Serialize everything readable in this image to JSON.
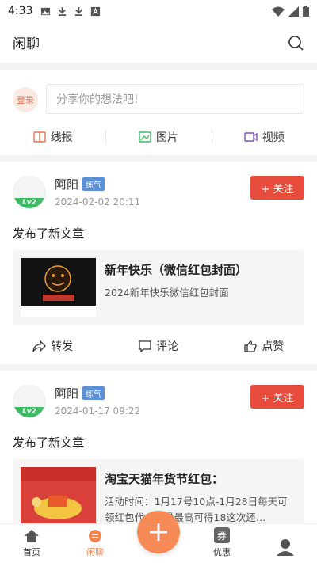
{
  "status_bar": {
    "time": "4:33",
    "icons": [
      "image-icon",
      "download-icon",
      "download-icon",
      "a-box-icon"
    ],
    "right_icons": [
      "wifi-icon",
      "signal-icon",
      "battery-icon"
    ]
  },
  "header": {
    "title": "闲聊",
    "search_icon": "search-icon"
  },
  "composer": {
    "login_label": "登录",
    "placeholder": "分享你的想法吧!",
    "types": [
      {
        "label": "线报",
        "icon": "book-icon",
        "color": "#e8734a"
      },
      {
        "label": "图片",
        "icon": "image-icon",
        "color": "#3dbb63"
      },
      {
        "label": "视频",
        "icon": "video-icon",
        "color": "#7a4fc9"
      }
    ]
  },
  "posts": [
    {
      "user": "阿阳",
      "badge": "练气",
      "level": "Lv2",
      "date": "2024-02-02 20:11",
      "follow_label": "+ 关注",
      "action": "发布了新文章",
      "article": {
        "title": "新年快乐（微信红包封面）",
        "desc": "2024新年快乐微信红包封面"
      },
      "actions": {
        "share": "转发",
        "comment": "评论",
        "like": "点赞"
      }
    },
    {
      "user": "阿阳",
      "badge": "练气",
      "level": "Lv2",
      "date": "2024-01-17 09:22",
      "follow_label": "+ 关注",
      "action": "发布了新文章",
      "article": {
        "title": "淘宝天猫年货节红包：",
        "desc": "活动时间：1月17号10点-1月28日每天可领红包代…能量最高可得18这次还…"
      }
    }
  ],
  "tabs": [
    {
      "label": "首页",
      "icon": "home-icon",
      "active": false
    },
    {
      "label": "闲聊",
      "icon": "chat-icon",
      "active": true
    },
    {
      "label": "",
      "icon": "plus-icon",
      "active": false
    },
    {
      "label": "优惠",
      "icon": "coupon-icon",
      "active": false
    },
    {
      "label": "",
      "icon": "user-icon",
      "active": false
    }
  ],
  "colors": {
    "accent": "#f68b58",
    "follow": "#e74c3c",
    "level": "#3dbb63",
    "badge": "#5b8fd6"
  }
}
